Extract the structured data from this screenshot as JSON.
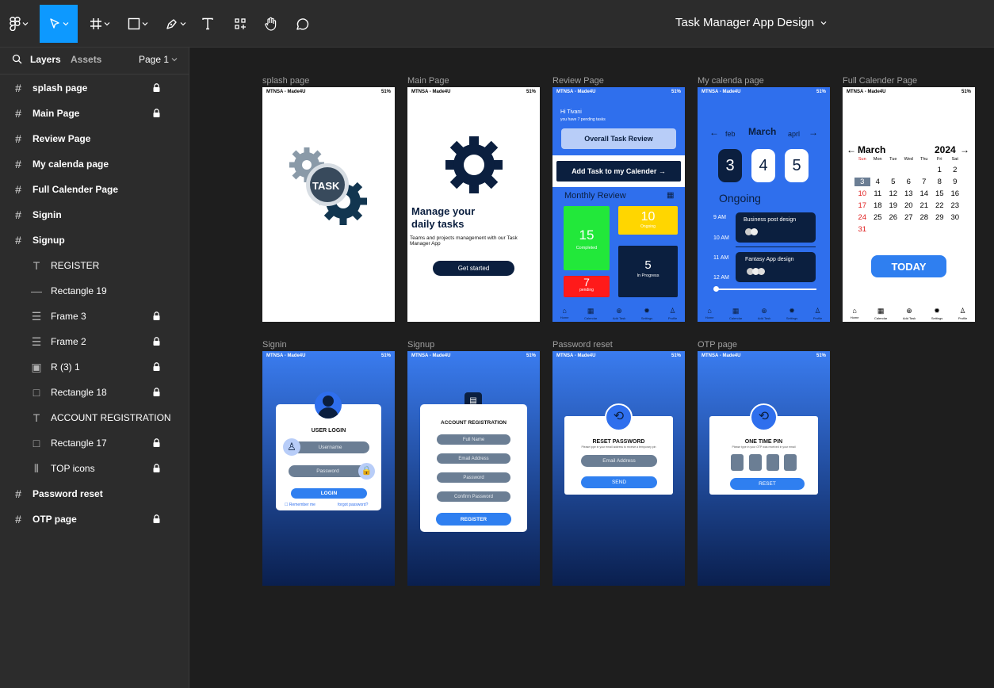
{
  "app": {
    "title": "Task Manager App Design"
  },
  "sidebar": {
    "tabs": {
      "layers": "Layers",
      "assets": "Assets",
      "page": "Page 1"
    },
    "layers": [
      {
        "label": "splash page",
        "level": 0,
        "icon": "frame-icon",
        "locked": true
      },
      {
        "label": "Main Page",
        "level": 0,
        "icon": "frame-icon",
        "locked": true
      },
      {
        "label": "Review Page",
        "level": 0,
        "icon": "frame-icon",
        "locked": false
      },
      {
        "label": "My calenda page",
        "level": 0,
        "icon": "frame-icon",
        "locked": false
      },
      {
        "label": "Full Calender Page",
        "level": 0,
        "icon": "frame-icon",
        "locked": false
      },
      {
        "label": "Signin",
        "level": 0,
        "icon": "frame-icon",
        "locked": false
      },
      {
        "label": "Signup",
        "level": 0,
        "icon": "frame-icon",
        "locked": false
      },
      {
        "label": "REGISTER",
        "level": 1,
        "icon": "text-icon",
        "locked": false
      },
      {
        "label": "Rectangle 19",
        "level": 1,
        "icon": "line-icon",
        "locked": false
      },
      {
        "label": "Frame 3",
        "level": 1,
        "icon": "rows-icon",
        "locked": true
      },
      {
        "label": "Frame 2",
        "level": 1,
        "icon": "rows-icon",
        "locked": true
      },
      {
        "label": "R (3) 1",
        "level": 1,
        "icon": "image-icon",
        "locked": true
      },
      {
        "label": "Rectangle 18",
        "level": 1,
        "icon": "rect-icon",
        "locked": true
      },
      {
        "label": "ACCOUNT REGISTRATION",
        "level": 1,
        "icon": "text-icon",
        "locked": false
      },
      {
        "label": "Rectangle 17",
        "level": 1,
        "icon": "rect-icon",
        "locked": true
      },
      {
        "label": "TOP icons",
        "level": 1,
        "icon": "columns-icon",
        "locked": true
      },
      {
        "label": "Password reset",
        "level": 0,
        "icon": "frame-icon",
        "locked": false
      },
      {
        "label": "OTP page",
        "level": 0,
        "icon": "frame-icon",
        "locked": true
      }
    ]
  },
  "frames": {
    "labels": [
      "splash page",
      "Main Page",
      "Review Page",
      "My calenda page",
      "Full Calender Page",
      "Signin",
      "Signup",
      "Password reset",
      "OTP page"
    ],
    "status": {
      "carrier": "MTNSA - Made4U",
      "battery": "51%"
    },
    "splash": {
      "logo": "TASK"
    },
    "main": {
      "headline1": "Manage your",
      "headline2": "daily tasks",
      "body": "Teams and projects management with our Task Manager App",
      "cta": "Get started"
    },
    "review": {
      "greeting": "Hi Tivani",
      "sub": "you have 7 pending tasks",
      "overall": "Overall Task Review",
      "add": "Add Task to my Calender",
      "monthly": "Monthly Review",
      "completed_n": "15",
      "completed": "Completed",
      "ongoing_n": "10",
      "ongoing": "Ongoing",
      "pending_n": "7",
      "pending": "pending",
      "progress_n": "5",
      "progress": "In Progress"
    },
    "nav": [
      "Home",
      "Calendar",
      "Add Task",
      "Settings",
      "Profile"
    ],
    "mycal": {
      "prev": "feb",
      "month": "March",
      "next": "aprl",
      "days": [
        "3",
        "4",
        "5"
      ],
      "ongoing": "Ongoing",
      "t1": "9 AM",
      "t2": "10 AM",
      "t3": "11 AM",
      "t4": "12 AM",
      "task1": "Business post design",
      "task2": "Fantasy App design"
    },
    "fullcal": {
      "month": "March",
      "year": "2024",
      "weekdays": [
        "Sun",
        "Mon",
        "Tue",
        "Wed",
        "Thu",
        "Fri",
        "Sat"
      ],
      "rows": [
        [
          "",
          "",
          "",
          "",
          "",
          "1",
          "2"
        ],
        [
          "3",
          "4",
          "5",
          "6",
          "7",
          "8",
          "9"
        ],
        [
          "10",
          "11",
          "12",
          "13",
          "14",
          "15",
          "16"
        ],
        [
          "17",
          "18",
          "19",
          "20",
          "21",
          "22",
          "23"
        ],
        [
          "24",
          "25",
          "26",
          "27",
          "28",
          "29",
          "30"
        ],
        [
          "31",
          "",
          "",
          "",
          "",
          "",
          ""
        ]
      ],
      "today": "TODAY"
    },
    "signin": {
      "title": "USER LOGIN",
      "username": "Username",
      "password": "Password",
      "login": "LOGIN",
      "remember": "Remember me",
      "forgot": "forgot password?"
    },
    "signup": {
      "title": "ACCOUNT REGISTRATION",
      "fields": [
        "Full Name",
        "Email Address",
        "Password",
        "Confirm Password"
      ],
      "register": "REGISTER"
    },
    "reset": {
      "title": "RESET PASSWORD",
      "hint": "Please type in your email address to receive a temporary pin",
      "email": "Email Address",
      "send": "SEND"
    },
    "otp": {
      "title": "ONE TIME PIN",
      "hint": "Please type in your OTP was received in your email",
      "reset": "RESET"
    }
  },
  "colors": {
    "accent": "#0d99ff",
    "blue": "#2f6fed",
    "navy": "#0b1f3f",
    "green": "#22e83a",
    "yellow": "#ffd600",
    "red": "#ff1a1a"
  }
}
